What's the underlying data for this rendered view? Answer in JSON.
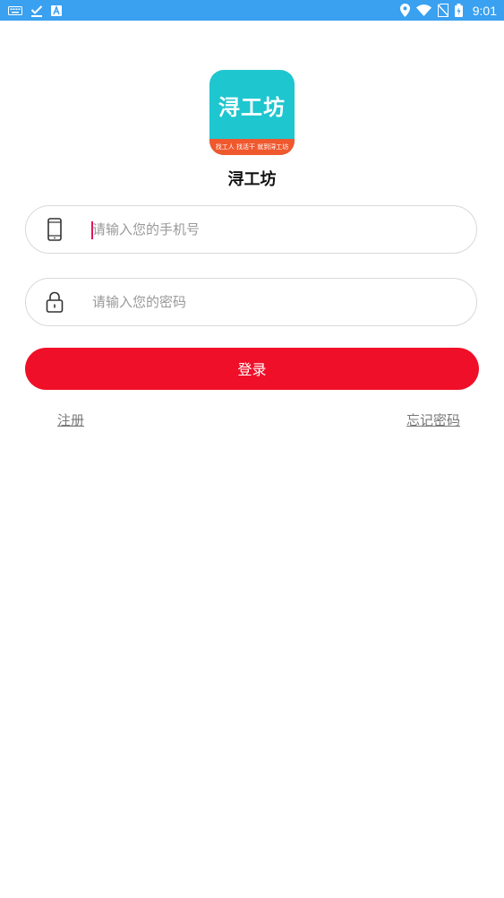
{
  "status_bar": {
    "time": "9:01",
    "left_icons": [
      "keyboard-icon",
      "download-done-icon",
      "a-icon"
    ],
    "right_icons": [
      "location-icon",
      "wifi-icon",
      "no-sim-icon",
      "battery-icon"
    ],
    "background": "#3aa0f0"
  },
  "app": {
    "logo_title": "浔工坊",
    "logo_tagline": "找工人 找活干 就到浔工坊",
    "name": "浔工坊"
  },
  "form": {
    "phone_placeholder": "请输入您的手机号",
    "password_placeholder": "请输入您的密码",
    "login_label": "登录",
    "register_label": "注册",
    "forgot_label": "忘记密码"
  },
  "colors": {
    "accent": "#f00f28",
    "logo_bg": "#1ec6cf",
    "logo_band": "#f0582e"
  }
}
